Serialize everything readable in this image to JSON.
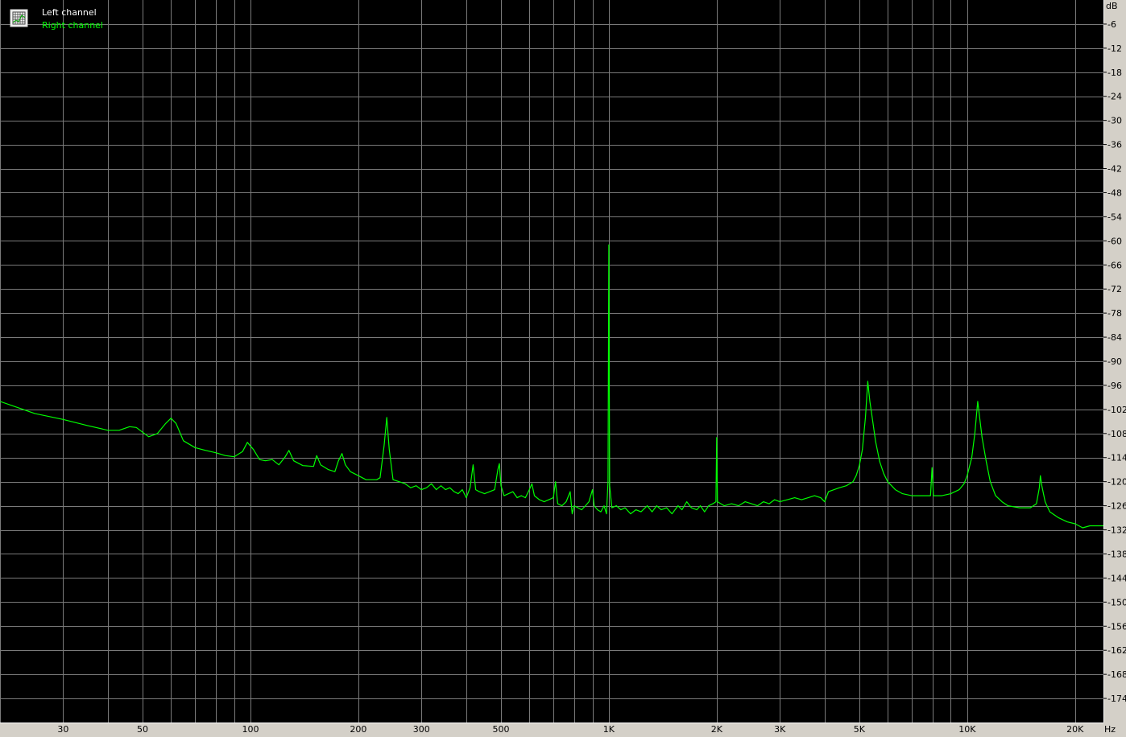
{
  "colors": {
    "plot_background": "#000000",
    "grid": "#7a7a7a",
    "left_channel": "#ffffff",
    "right_channel": "#00ff00",
    "frame": "#d4d0c8"
  },
  "icons": {
    "legend_toggle": "grid-icon"
  },
  "chart_data": {
    "type": "line",
    "legend": {
      "position": "top-left",
      "entries": [
        "Left channel",
        "Right channel"
      ]
    },
    "x_unit": "Hz",
    "y_unit": "dB",
    "x_scale": "log",
    "xlim": [
      20,
      24000
    ],
    "ylim": [
      -180,
      0
    ],
    "grid": true,
    "x_major_grid": [
      20,
      30,
      40,
      50,
      60,
      70,
      80,
      90,
      100,
      200,
      300,
      400,
      500,
      600,
      700,
      800,
      900,
      1000,
      2000,
      3000,
      4000,
      5000,
      6000,
      7000,
      8000,
      9000,
      10000,
      20000
    ],
    "x_ticks": [
      {
        "value": 30,
        "label": "30"
      },
      {
        "value": 50,
        "label": "50"
      },
      {
        "value": 100,
        "label": "100"
      },
      {
        "value": 200,
        "label": "200"
      },
      {
        "value": 300,
        "label": "300"
      },
      {
        "value": 500,
        "label": "500"
      },
      {
        "value": 1000,
        "label": "1K"
      },
      {
        "value": 2000,
        "label": "2K"
      },
      {
        "value": 3000,
        "label": "3K"
      },
      {
        "value": 5000,
        "label": "5K"
      },
      {
        "value": 10000,
        "label": "10K"
      },
      {
        "value": 20000,
        "label": "20K"
      }
    ],
    "y_ticks": [
      {
        "value": -6,
        "label": "-6"
      },
      {
        "value": -12,
        "label": "-12"
      },
      {
        "value": -18,
        "label": "-18"
      },
      {
        "value": -24,
        "label": "-24"
      },
      {
        "value": -30,
        "label": "-30"
      },
      {
        "value": -36,
        "label": "-36"
      },
      {
        "value": -42,
        "label": "-42"
      },
      {
        "value": -48,
        "label": "-48"
      },
      {
        "value": -54,
        "label": "-54"
      },
      {
        "value": -60,
        "label": "-60"
      },
      {
        "value": -66,
        "label": "-66"
      },
      {
        "value": -72,
        "label": "-72"
      },
      {
        "value": -78,
        "label": "-78"
      },
      {
        "value": -84,
        "label": "-84"
      },
      {
        "value": -90,
        "label": "-90"
      },
      {
        "value": -96,
        "label": "-96"
      },
      {
        "value": -102,
        "label": "-102"
      },
      {
        "value": -108,
        "label": "-108"
      },
      {
        "value": -114,
        "label": "-114"
      },
      {
        "value": -120,
        "label": "-120"
      },
      {
        "value": -126,
        "label": "-126"
      },
      {
        "value": -132,
        "label": "-132"
      },
      {
        "value": -138,
        "label": "-138"
      },
      {
        "value": -144,
        "label": "-144"
      },
      {
        "value": -150,
        "label": "-150"
      },
      {
        "value": -156,
        "label": "-156"
      },
      {
        "value": -162,
        "label": "-162"
      },
      {
        "value": -168,
        "label": "-168"
      },
      {
        "value": -174,
        "label": "-174"
      }
    ],
    "series": [
      {
        "name": "Right channel",
        "color": "#00ff00",
        "points": [
          [
            20,
            -100
          ],
          [
            25,
            -103
          ],
          [
            30,
            -104.5
          ],
          [
            35,
            -106
          ],
          [
            40,
            -107.2
          ],
          [
            43,
            -107.2
          ],
          [
            46,
            -106.3
          ],
          [
            48,
            -106.5
          ],
          [
            52,
            -108.8
          ],
          [
            55,
            -108
          ],
          [
            58,
            -105.5
          ],
          [
            60,
            -104.2
          ],
          [
            62,
            -105.5
          ],
          [
            65,
            -109.8
          ],
          [
            70,
            -111.5
          ],
          [
            75,
            -112.2
          ],
          [
            80,
            -112.8
          ],
          [
            85,
            -113.5
          ],
          [
            90,
            -113.8
          ],
          [
            95,
            -112.5
          ],
          [
            98,
            -110.2
          ],
          [
            102,
            -112
          ],
          [
            106,
            -114.5
          ],
          [
            110,
            -114.8
          ],
          [
            115,
            -114.5
          ],
          [
            120,
            -115.8
          ],
          [
            125,
            -113.8
          ],
          [
            128,
            -112.2
          ],
          [
            132,
            -114.8
          ],
          [
            140,
            -116
          ],
          [
            150,
            -116.2
          ],
          [
            153,
            -113.5
          ],
          [
            157,
            -115.8
          ],
          [
            165,
            -117
          ],
          [
            172,
            -117.5
          ],
          [
            176,
            -114.8
          ],
          [
            180,
            -113
          ],
          [
            184,
            -115.8
          ],
          [
            190,
            -117.5
          ],
          [
            200,
            -118.5
          ],
          [
            210,
            -119.5
          ],
          [
            225,
            -119.5
          ],
          [
            230,
            -119
          ],
          [
            236,
            -111
          ],
          [
            240,
            -104
          ],
          [
            244,
            -112
          ],
          [
            250,
            -119.5
          ],
          [
            260,
            -120
          ],
          [
            270,
            -120.5
          ],
          [
            280,
            -121.5
          ],
          [
            290,
            -121
          ],
          [
            300,
            -122
          ],
          [
            310,
            -121.5
          ],
          [
            320,
            -120.5
          ],
          [
            330,
            -122
          ],
          [
            340,
            -121
          ],
          [
            350,
            -122
          ],
          [
            360,
            -121.5
          ],
          [
            370,
            -122.5
          ],
          [
            380,
            -123
          ],
          [
            390,
            -122
          ],
          [
            400,
            -124
          ],
          [
            410,
            -121.5
          ],
          [
            418,
            -115.8
          ],
          [
            425,
            -122
          ],
          [
            435,
            -122.5
          ],
          [
            450,
            -123
          ],
          [
            465,
            -122.5
          ],
          [
            480,
            -122
          ],
          [
            490,
            -117
          ],
          [
            495,
            -115.5
          ],
          [
            500,
            -121
          ],
          [
            510,
            -123.5
          ],
          [
            525,
            -123
          ],
          [
            540,
            -122.5
          ],
          [
            555,
            -124
          ],
          [
            570,
            -123.5
          ],
          [
            585,
            -124
          ],
          [
            600,
            -122
          ],
          [
            610,
            -120.5
          ],
          [
            620,
            -123.5
          ],
          [
            640,
            -124.5
          ],
          [
            660,
            -125
          ],
          [
            680,
            -124.5
          ],
          [
            700,
            -124
          ],
          [
            710,
            -120
          ],
          [
            720,
            -125.5
          ],
          [
            740,
            -126
          ],
          [
            760,
            -125
          ],
          [
            780,
            -122.5
          ],
          [
            790,
            -128
          ],
          [
            800,
            -126
          ],
          [
            820,
            -126.5
          ],
          [
            840,
            -127
          ],
          [
            860,
            -126
          ],
          [
            880,
            -125
          ],
          [
            900,
            -122
          ],
          [
            910,
            -126
          ],
          [
            930,
            -127
          ],
          [
            950,
            -127.5
          ],
          [
            970,
            -126
          ],
          [
            985,
            -128
          ],
          [
            995,
            -120
          ],
          [
            1000,
            -61
          ],
          [
            1005,
            -121
          ],
          [
            1020,
            -126.5
          ],
          [
            1050,
            -126
          ],
          [
            1080,
            -127
          ],
          [
            1110,
            -126.5
          ],
          [
            1150,
            -128
          ],
          [
            1190,
            -127
          ],
          [
            1230,
            -127.5
          ],
          [
            1280,
            -126
          ],
          [
            1320,
            -127.5
          ],
          [
            1360,
            -126
          ],
          [
            1400,
            -127
          ],
          [
            1450,
            -126.5
          ],
          [
            1500,
            -128
          ],
          [
            1560,
            -126
          ],
          [
            1600,
            -127
          ],
          [
            1650,
            -125
          ],
          [
            1700,
            -126.5
          ],
          [
            1760,
            -127
          ],
          [
            1800,
            -126
          ],
          [
            1850,
            -127.5
          ],
          [
            1900,
            -126
          ],
          [
            1950,
            -125.5
          ],
          [
            1990,
            -125
          ],
          [
            2000,
            -109
          ],
          [
            2010,
            -125
          ],
          [
            2100,
            -126
          ],
          [
            2200,
            -125.5
          ],
          [
            2300,
            -126
          ],
          [
            2400,
            -125
          ],
          [
            2500,
            -125.5
          ],
          [
            2600,
            -126
          ],
          [
            2700,
            -125
          ],
          [
            2800,
            -125.5
          ],
          [
            2900,
            -124.5
          ],
          [
            3000,
            -125
          ],
          [
            3150,
            -124.5
          ],
          [
            3300,
            -124
          ],
          [
            3450,
            -124.5
          ],
          [
            3600,
            -124
          ],
          [
            3750,
            -123.5
          ],
          [
            3900,
            -124
          ],
          [
            4000,
            -125
          ],
          [
            4100,
            -122.5
          ],
          [
            4250,
            -122
          ],
          [
            4400,
            -121.5
          ],
          [
            4600,
            -121
          ],
          [
            4800,
            -120
          ],
          [
            4900,
            -118.5
          ],
          [
            5000,
            -116
          ],
          [
            5100,
            -112
          ],
          [
            5200,
            -104
          ],
          [
            5280,
            -95
          ],
          [
            5350,
            -100
          ],
          [
            5450,
            -105
          ],
          [
            5550,
            -110
          ],
          [
            5700,
            -115
          ],
          [
            5850,
            -118
          ],
          [
            6000,
            -120
          ],
          [
            6300,
            -122
          ],
          [
            6600,
            -123
          ],
          [
            7000,
            -123.5
          ],
          [
            7500,
            -123.5
          ],
          [
            7900,
            -123.5
          ],
          [
            7980,
            -116.5
          ],
          [
            8050,
            -123.5
          ],
          [
            8500,
            -123.5
          ],
          [
            9000,
            -123
          ],
          [
            9500,
            -122
          ],
          [
            9800,
            -120.5
          ],
          [
            10000,
            -118.5
          ],
          [
            10300,
            -114
          ],
          [
            10500,
            -108
          ],
          [
            10650,
            -102
          ],
          [
            10700,
            -100
          ],
          [
            10800,
            -103
          ],
          [
            11000,
            -109
          ],
          [
            11300,
            -115
          ],
          [
            11600,
            -120
          ],
          [
            12000,
            -123.5
          ],
          [
            12500,
            -125
          ],
          [
            13000,
            -126
          ],
          [
            14000,
            -126.5
          ],
          [
            15000,
            -126.5
          ],
          [
            15600,
            -125.5
          ],
          [
            15900,
            -121.5
          ],
          [
            16000,
            -118.5
          ],
          [
            16150,
            -121
          ],
          [
            16500,
            -125
          ],
          [
            17000,
            -127.5
          ],
          [
            18000,
            -129
          ],
          [
            19000,
            -130
          ],
          [
            20000,
            -130.5
          ],
          [
            21000,
            -131.5
          ],
          [
            22000,
            -131
          ],
          [
            24000,
            -131
          ]
        ]
      }
    ]
  }
}
